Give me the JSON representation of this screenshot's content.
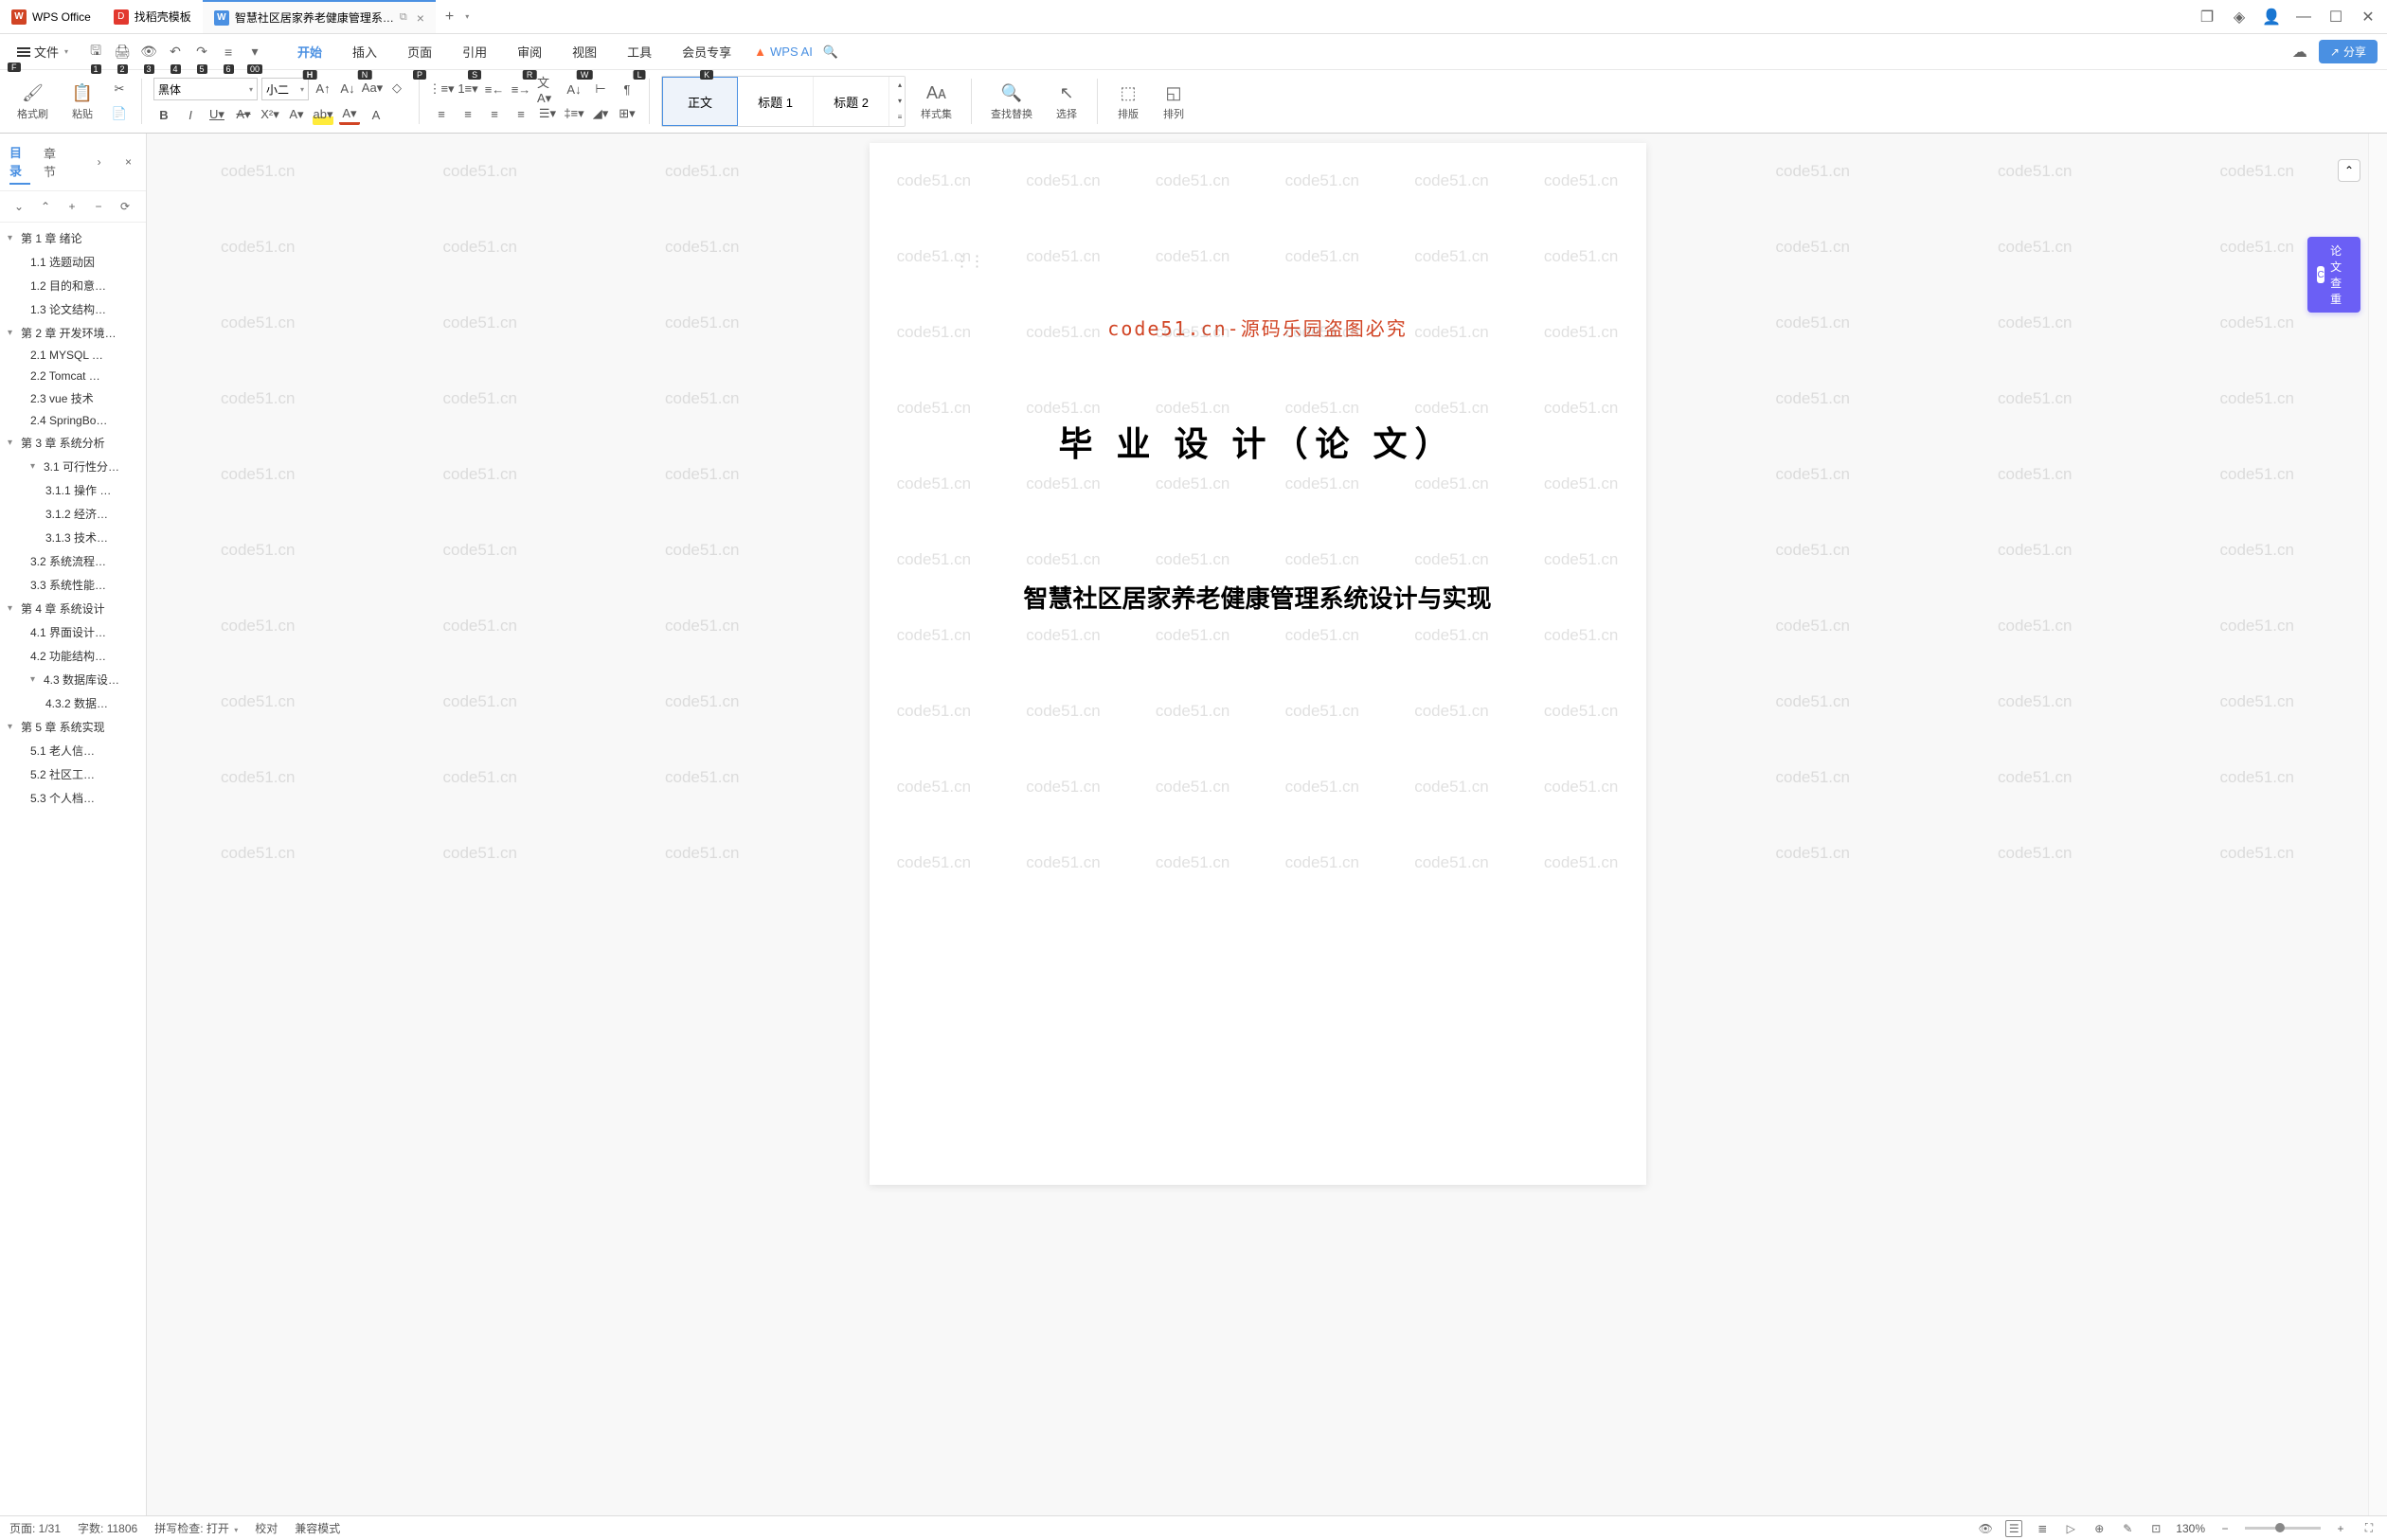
{
  "tabs": {
    "wps": "WPS Office",
    "templates": "找稻壳模板",
    "document": "智慧社区居家养老健康管理系…"
  },
  "menu": {
    "file": "文件",
    "file_key": "F",
    "items": [
      "开始",
      "插入",
      "页面",
      "引用",
      "审阅",
      "视图",
      "工具",
      "会员专享"
    ],
    "keys": [
      "H",
      "N",
      "P",
      "S",
      "R",
      "W",
      "L",
      "K"
    ],
    "active_index": 0,
    "wps_ai": "WPS AI",
    "share": "分享"
  },
  "qat_keys": [
    "1",
    "2",
    "3",
    "4",
    "5",
    "6",
    "00"
  ],
  "ribbon": {
    "format_painter": "格式刷",
    "paste": "粘贴",
    "font_name": "黑体",
    "font_size": "小二",
    "styles": {
      "normal": "正文",
      "heading1": "标题 1",
      "heading2": "标题 2",
      "styleset": "样式集",
      "findreplace": "查找替换",
      "select": "选择",
      "arrange_v": "排版",
      "arrange_h": "排列"
    }
  },
  "sidebar": {
    "tab_toc": "目录",
    "tab_chapter": "章节",
    "items": [
      {
        "level": 1,
        "text": "第 1 章  绪论",
        "expand": true
      },
      {
        "level": 2,
        "text": "1.1 选题动因"
      },
      {
        "level": 2,
        "text": "1.2 目的和意…"
      },
      {
        "level": 2,
        "text": "1.3 论文结构…"
      },
      {
        "level": 1,
        "text": "第 2 章  开发环境…",
        "expand": true
      },
      {
        "level": 2,
        "text": "2.1 MYSQL …"
      },
      {
        "level": 2,
        "text": "2.2 Tomcat …"
      },
      {
        "level": 2,
        "text": "2.3 vue 技术"
      },
      {
        "level": 2,
        "text": "2.4 SpringBo…"
      },
      {
        "level": 1,
        "text": "第 3 章  系统分析",
        "expand": true
      },
      {
        "level": 2,
        "text": "3.1 可行性分…",
        "expand": true
      },
      {
        "level": 3,
        "text": "3.1.1 操作 …"
      },
      {
        "level": 3,
        "text": "3.1.2 经济…"
      },
      {
        "level": 3,
        "text": "3.1.3 技术…"
      },
      {
        "level": 2,
        "text": "3.2 系统流程…"
      },
      {
        "level": 2,
        "text": "3.3 系统性能…"
      },
      {
        "level": 1,
        "text": "第 4 章  系统设计",
        "expand": true
      },
      {
        "level": 2,
        "text": "4.1 界面设计…"
      },
      {
        "level": 2,
        "text": "4.2 功能结构…"
      },
      {
        "level": 2,
        "text": "4.3 数据库设…",
        "expand": true
      },
      {
        "level": 3,
        "text": "4.3.2  数据…"
      },
      {
        "level": 1,
        "text": "第 5 章  系统实现",
        "expand": true
      },
      {
        "level": 2,
        "text": "5.1 老人信…"
      },
      {
        "level": 2,
        "text": "5.2 社区工…"
      },
      {
        "level": 2,
        "text": "5.3 个人档…"
      }
    ]
  },
  "document": {
    "watermark_text": "code51.cn",
    "warning": "code51.cn-源码乐园盗图必究",
    "title": "毕 业 设 计（论 文）",
    "subtitle": "智慧社区居家养老健康管理系统设计与实现"
  },
  "plagiarism": "论文查重",
  "statusbar": {
    "page": "页面: 1/31",
    "words": "字数: 11806",
    "spellcheck": "拼写检查: 打开",
    "proofing": "校对",
    "compat": "兼容模式",
    "zoom": "130%"
  }
}
